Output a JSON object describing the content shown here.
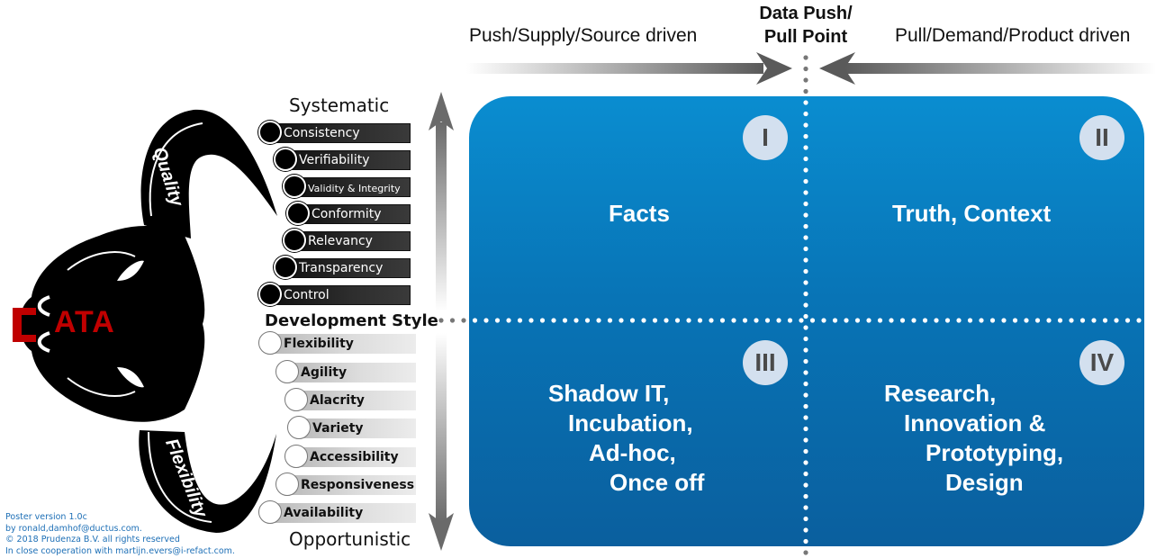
{
  "header": {
    "push_label": "Push/Supply/Source driven",
    "center_line1": "Data Push/",
    "center_line2": "Pull Point",
    "pull_label": "Pull/Demand/Product driven"
  },
  "axis": {
    "top_label": "Systematic",
    "middle_label": "Development Style",
    "bottom_label": "Opportunistic"
  },
  "quality_items": [
    "Consistency",
    "Verifiability",
    "Validity & Integrity",
    "Conformity",
    "Relevancy",
    "Transparency",
    "Control"
  ],
  "flexibility_items": [
    "Flexibility",
    "Agility",
    "Alacrity",
    "Variety",
    "Accessibility",
    "Responsiveness",
    "Availability"
  ],
  "logo": {
    "text": "ATA",
    "quality_horn": "Quality",
    "flexibility_horn": "Flexibility"
  },
  "quadrants": [
    {
      "numeral": "I",
      "lines": [
        "Facts"
      ]
    },
    {
      "numeral": "II",
      "lines": [
        "Truth, Context"
      ]
    },
    {
      "numeral": "III",
      "lines": [
        "Shadow IT,",
        "Incubation,",
        "Ad-hoc,",
        "Once off"
      ]
    },
    {
      "numeral": "IV",
      "lines": [
        "Research,",
        "Innovation &",
        "Prototyping,",
        "Design"
      ]
    }
  ],
  "footer": {
    "line1": "Poster version 1.0c",
    "line2": "by  ronald,damhof@ductus.com.",
    "line3": "© 2018 Prudenza B.V. all rights reserved",
    "line4": "In close cooperation with martijn.evers@i-refact.com."
  },
  "colors": {
    "board_top": "#0a8dd0",
    "board_bottom": "#0a5f9e",
    "logo_red": "#c00000",
    "footer_blue": "#1d6fb6",
    "numeral_bg": "#d3e0ef"
  }
}
